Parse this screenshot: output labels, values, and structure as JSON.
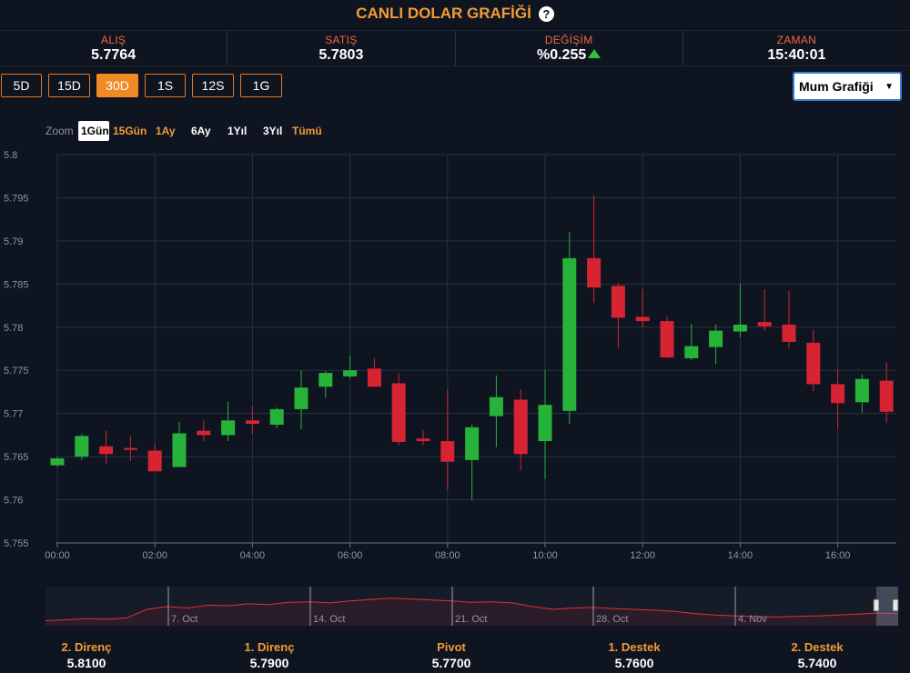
{
  "header": {
    "title": "CANLI DOLAR GRAFİĞİ",
    "help": "?"
  },
  "stats": [
    {
      "label": "ALIŞ",
      "value": "5.7764"
    },
    {
      "label": "SATIŞ",
      "value": "5.7803"
    },
    {
      "label": "DEĞİŞİM",
      "value": "%0.255"
    },
    {
      "label": "ZAMAN",
      "value": "15:40:01"
    }
  ],
  "ranges": [
    "5D",
    "15D",
    "30D",
    "1S",
    "12S",
    "1G"
  ],
  "active_range": "30D",
  "chart_type_select": "Mum Grafiği",
  "zoom": {
    "label": "Zoom",
    "options": [
      "1Gün",
      "15Gün",
      "1Ay",
      "6Ay",
      "1Yıl",
      "3Yıl",
      "Tümü"
    ],
    "selected": "1Gün"
  },
  "colors": {
    "up": "#27b33a",
    "down": "#d62433",
    "accent": "#f08a24",
    "background": "#0f1421",
    "grid": "#283040"
  },
  "chart_data": {
    "type": "candlestick",
    "x_unit": "hours",
    "x_ticks": [
      "00:00",
      "02:00",
      "04:00",
      "06:00",
      "08:00",
      "10:00",
      "12:00",
      "14:00",
      "16:00"
    ],
    "ylim": [
      5.755,
      5.8
    ],
    "y_ticks": [
      "5.755",
      "5.76",
      "5.765",
      "5.77",
      "5.775",
      "5.78",
      "5.785",
      "5.79",
      "5.795",
      "5.8"
    ],
    "candles": [
      {
        "t": 0.0,
        "o": 5.764,
        "h": 5.765,
        "l": 5.7638,
        "c": 5.7648
      },
      {
        "t": 0.5,
        "o": 5.765,
        "h": 5.7676,
        "l": 5.7646,
        "c": 5.7674
      },
      {
        "t": 1.0,
        "o": 5.7662,
        "h": 5.768,
        "l": 5.7642,
        "c": 5.7653
      },
      {
        "t": 1.5,
        "o": 5.766,
        "h": 5.7674,
        "l": 5.7645,
        "c": 5.7658
      },
      {
        "t": 2.0,
        "o": 5.7657,
        "h": 5.7665,
        "l": 5.7633,
        "c": 5.7633
      },
      {
        "t": 2.5,
        "o": 5.7638,
        "h": 5.769,
        "l": 5.7638,
        "c": 5.7677
      },
      {
        "t": 3.0,
        "o": 5.768,
        "h": 5.7692,
        "l": 5.7668,
        "c": 5.7675
      },
      {
        "t": 3.5,
        "o": 5.7675,
        "h": 5.7714,
        "l": 5.7668,
        "c": 5.7692
      },
      {
        "t": 4.0,
        "o": 5.7692,
        "h": 5.7708,
        "l": 5.7676,
        "c": 5.7688
      },
      {
        "t": 4.5,
        "o": 5.7687,
        "h": 5.7707,
        "l": 5.7683,
        "c": 5.7705
      },
      {
        "t": 5.0,
        "o": 5.7705,
        "h": 5.775,
        "l": 5.7682,
        "c": 5.773
      },
      {
        "t": 5.5,
        "o": 5.7731,
        "h": 5.7749,
        "l": 5.7718,
        "c": 5.7747
      },
      {
        "t": 6.0,
        "o": 5.7743,
        "h": 5.7767,
        "l": 5.774,
        "c": 5.775
      },
      {
        "t": 6.5,
        "o": 5.7752,
        "h": 5.7764,
        "l": 5.7731,
        "c": 5.7731
      },
      {
        "t": 7.0,
        "o": 5.7735,
        "h": 5.7747,
        "l": 5.7663,
        "c": 5.7667
      },
      {
        "t": 7.5,
        "o": 5.7671,
        "h": 5.7681,
        "l": 5.7663,
        "c": 5.7668
      },
      {
        "t": 8.0,
        "o": 5.7668,
        "h": 5.7728,
        "l": 5.7611,
        "c": 5.7644
      },
      {
        "t": 8.5,
        "o": 5.7646,
        "h": 5.7687,
        "l": 5.76,
        "c": 5.7684
      },
      {
        "t": 9.0,
        "o": 5.7697,
        "h": 5.7744,
        "l": 5.7661,
        "c": 5.7719
      },
      {
        "t": 9.5,
        "o": 5.7716,
        "h": 5.7728,
        "l": 5.7634,
        "c": 5.7653
      },
      {
        "t": 10.0,
        "o": 5.7668,
        "h": 5.775,
        "l": 5.7624,
        "c": 5.771
      },
      {
        "t": 10.5,
        "o": 5.7703,
        "h": 5.791,
        "l": 5.7688,
        "c": 5.788
      },
      {
        "t": 11.0,
        "o": 5.788,
        "h": 5.7953,
        "l": 5.7828,
        "c": 5.7846
      },
      {
        "t": 11.5,
        "o": 5.7848,
        "h": 5.7851,
        "l": 5.7775,
        "c": 5.7811
      },
      {
        "t": 12.0,
        "o": 5.7812,
        "h": 5.7844,
        "l": 5.78,
        "c": 5.7807
      },
      {
        "t": 12.5,
        "o": 5.7807,
        "h": 5.7812,
        "l": 5.7764,
        "c": 5.7765
      },
      {
        "t": 13.0,
        "o": 5.7764,
        "h": 5.7804,
        "l": 5.7762,
        "c": 5.7778
      },
      {
        "t": 13.5,
        "o": 5.7777,
        "h": 5.7803,
        "l": 5.7757,
        "c": 5.7796
      },
      {
        "t": 14.0,
        "o": 5.7795,
        "h": 5.785,
        "l": 5.7788,
        "c": 5.7803
      },
      {
        "t": 14.5,
        "o": 5.7806,
        "h": 5.7844,
        "l": 5.7796,
        "c": 5.7801
      },
      {
        "t": 15.0,
        "o": 5.7803,
        "h": 5.7842,
        "l": 5.7776,
        "c": 5.7783
      },
      {
        "t": 15.5,
        "o": 5.7782,
        "h": 5.7797,
        "l": 5.7726,
        "c": 5.7734
      },
      {
        "t": 16.0,
        "o": 5.7734,
        "h": 5.7751,
        "l": 5.7682,
        "c": 5.7712
      },
      {
        "t": 16.5,
        "o": 5.7713,
        "h": 5.7745,
        "l": 5.7701,
        "c": 5.774
      },
      {
        "t": 17.0,
        "o": 5.7738,
        "h": 5.7759,
        "l": 5.7689,
        "c": 5.7702
      }
    ]
  },
  "navigator": {
    "labels": [
      "7. Oct",
      "14. Oct",
      "21. Oct",
      "28. Oct",
      "4. Nov"
    ],
    "series": [
      0.05,
      0.08,
      0.12,
      0.1,
      0.15,
      0.45,
      0.55,
      0.5,
      0.6,
      0.58,
      0.65,
      0.62,
      0.7,
      0.72,
      0.68,
      0.75,
      0.8,
      0.85,
      0.82,
      0.78,
      0.75,
      0.7,
      0.72,
      0.68,
      0.55,
      0.45,
      0.5,
      0.52,
      0.48,
      0.45,
      0.42,
      0.38,
      0.3,
      0.25,
      0.22,
      0.2,
      0.18,
      0.2,
      0.22,
      0.25,
      0.28,
      0.32,
      0.3
    ]
  },
  "levels": [
    {
      "label": "2. Direnç",
      "value": "5.8100"
    },
    {
      "label": "1. Direnç",
      "value": "5.7900"
    },
    {
      "label": "Pivot",
      "value": "5.7700"
    },
    {
      "label": "1. Destek",
      "value": "5.7600"
    },
    {
      "label": "2. Destek",
      "value": "5.7400"
    }
  ]
}
